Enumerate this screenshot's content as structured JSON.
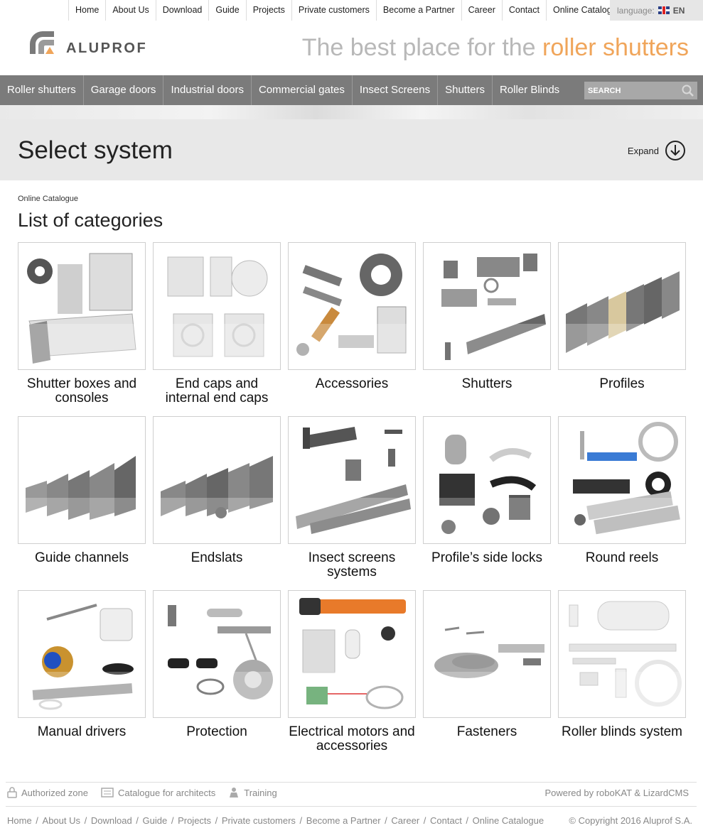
{
  "top_nav": {
    "items": [
      "Home",
      "About Us",
      "Download",
      "Guide",
      "Projects",
      "Private customers",
      "Become a Partner",
      "Career",
      "Contact",
      "Online Catalogue"
    ],
    "language_label": "language:",
    "language_code": "EN"
  },
  "brand": {
    "name": "ALUPROF",
    "tagline_plain": "The best place for the ",
    "tagline_accent": "roller shutters",
    "accent_color": "#f0a55a"
  },
  "main_nav": {
    "items": [
      "Roller shutters",
      "Garage doors",
      "Industrial doors",
      "Commercial gates",
      "Insect Screens",
      "Shutters",
      "Roller Blinds"
    ],
    "search_placeholder": "SEARCH"
  },
  "select_system": {
    "title": "Select system",
    "expand_label": "Expand"
  },
  "breadcrumb": "Online Catalogue",
  "page_title": "List of categories",
  "categories": [
    {
      "label": "Shutter boxes and consoles",
      "icon": "shutter-boxes-image"
    },
    {
      "label": "End caps and internal end caps",
      "icon": "end-caps-image"
    },
    {
      "label": "Accessories",
      "icon": "accessories-image"
    },
    {
      "label": "Shutters",
      "icon": "shutters-image"
    },
    {
      "label": "Profiles",
      "icon": "profiles-image"
    },
    {
      "label": "Guide channels",
      "icon": "guide-channels-image"
    },
    {
      "label": "Endslats",
      "icon": "endslats-image"
    },
    {
      "label": "Insect screens systems",
      "icon": "insect-screens-image"
    },
    {
      "label": "Profile’s side locks",
      "icon": "side-locks-image"
    },
    {
      "label": "Round reels",
      "icon": "round-reels-image"
    },
    {
      "label": "Manual drivers",
      "icon": "manual-drivers-image"
    },
    {
      "label": "Protection",
      "icon": "protection-image"
    },
    {
      "label": "Electrical motors and accessories",
      "icon": "electrical-motors-image"
    },
    {
      "label": "Fasteners",
      "icon": "fasteners-image"
    },
    {
      "label": "Roller blinds system",
      "icon": "roller-blinds-image"
    }
  ],
  "footer": {
    "tools": [
      "Authorized zone",
      "Catalogue for architects",
      "Training"
    ],
    "powered": "Powered by roboKAT & LizardCMS",
    "links": [
      "Home",
      "About Us",
      "Download",
      "Guide",
      "Projects",
      "Private customers",
      "Become a Partner",
      "Career",
      "Contact",
      "Online Catalogue"
    ],
    "copyright": "© Copyright 2016 Aluprof S.A."
  }
}
